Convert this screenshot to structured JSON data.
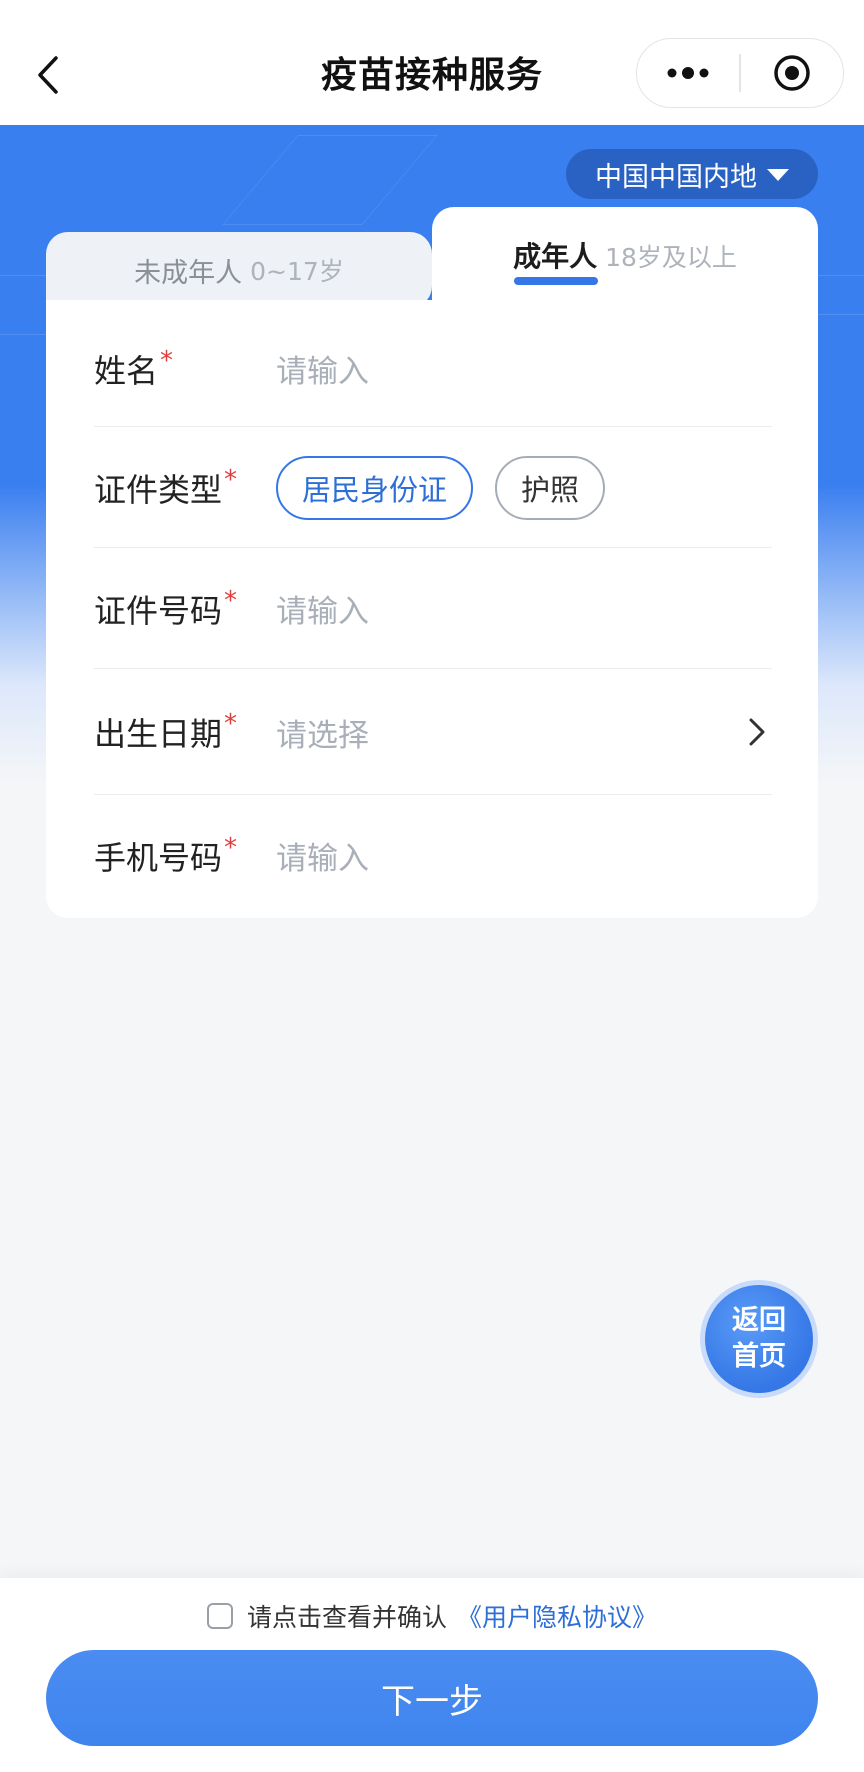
{
  "navbar": {
    "title": "疫苗接种服务"
  },
  "region": {
    "label": "中国中国内地"
  },
  "tabs": [
    {
      "label": "未成年人",
      "sub": "0~17岁",
      "active": false
    },
    {
      "label": "成年人",
      "sub": "18岁及以上",
      "active": true
    }
  ],
  "form": {
    "name": {
      "label": "姓名",
      "placeholder": "请输入"
    },
    "id_type": {
      "label": "证件类型",
      "options": [
        "居民身份证",
        "护照"
      ],
      "selected": "居民身份证"
    },
    "id_number": {
      "label": "证件号码",
      "placeholder": "请输入"
    },
    "birth_date": {
      "label": "出生日期",
      "placeholder": "请选择"
    },
    "phone": {
      "label": "手机号码",
      "placeholder": "请输入"
    },
    "required_mark": "*"
  },
  "fab": {
    "label": "返回首页"
  },
  "agreement": {
    "text": "请点击查看并确认",
    "link": "《用户隐私协议》"
  },
  "next_button": {
    "label": "下一步"
  },
  "colors": {
    "primary": "#3577e6",
    "hero": "#3a7ff0",
    "required": "#e23d3d",
    "placeholder": "#a9afb8"
  }
}
